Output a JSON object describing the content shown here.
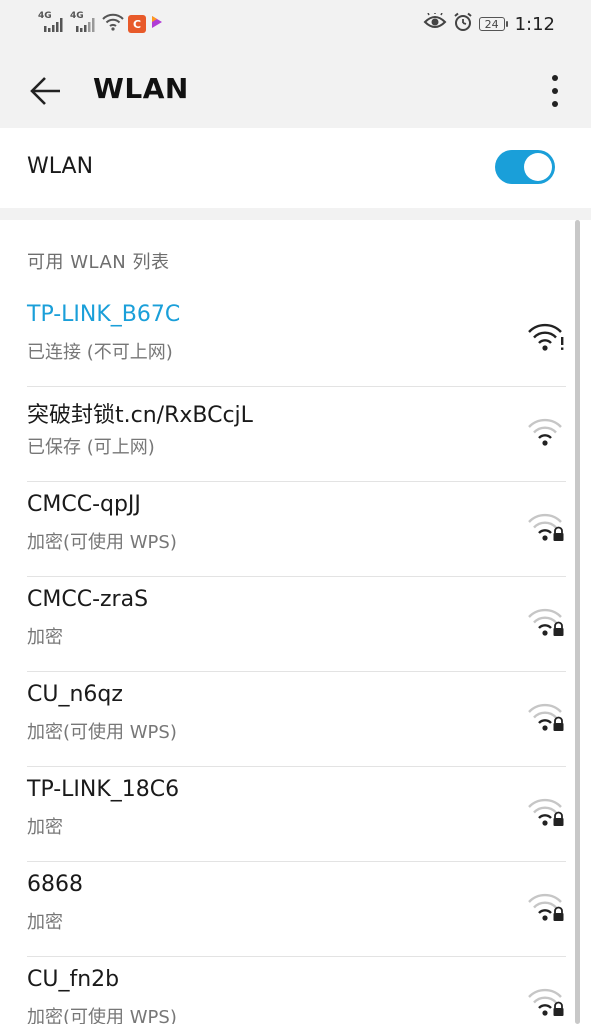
{
  "status_bar": {
    "net1_label": "4G",
    "net2_label": "4G",
    "battery": "24",
    "time": "1:12",
    "icons": [
      "signal-icon",
      "signal-icon",
      "wifi-icon",
      "app-notification-icon",
      "video-app-icon",
      "eye-comfort-icon",
      "alarm-icon",
      "battery-icon"
    ]
  },
  "app_bar": {
    "title": "WLAN"
  },
  "wlan_toggle": {
    "label": "WLAN",
    "enabled": true,
    "accent": "#1a9fd9"
  },
  "networks_section": {
    "title": "可用 WLAN 列表",
    "items": [
      {
        "name": "TP-LINK_B67C",
        "status": "已连接 (不可上网)",
        "connected": true,
        "locked": false,
        "signal": "full-warning"
      },
      {
        "name": "突破封锁t.cn/RxBCcjL",
        "status": "已保存 (可上网)",
        "connected": false,
        "locked": false,
        "signal": "weak"
      },
      {
        "name": "CMCC-qpJJ",
        "status": "加密(可使用 WPS)",
        "connected": false,
        "locked": true,
        "signal": "weak"
      },
      {
        "name": "CMCC-zraS",
        "status": "加密",
        "connected": false,
        "locked": true,
        "signal": "weak"
      },
      {
        "name": "CU_n6qz",
        "status": "加密(可使用 WPS)",
        "connected": false,
        "locked": true,
        "signal": "weak"
      },
      {
        "name": "TP-LINK_18C6",
        "status": "加密",
        "connected": false,
        "locked": true,
        "signal": "weak"
      },
      {
        "name": "6868",
        "status": "加密",
        "connected": false,
        "locked": true,
        "signal": "weak"
      },
      {
        "name": "CU_fn2b",
        "status": "加密(可使用 WPS)",
        "connected": false,
        "locked": true,
        "signal": "weak"
      }
    ]
  }
}
